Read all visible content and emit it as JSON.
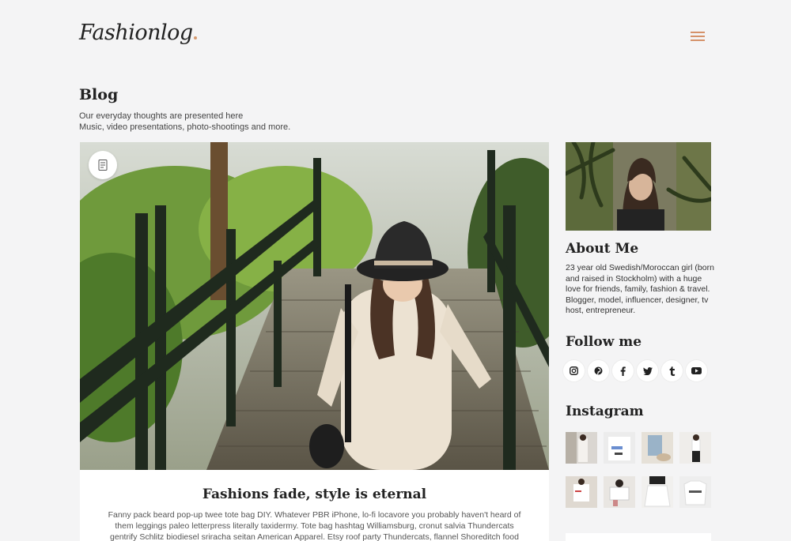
{
  "site": {
    "logo": "Fashionlog"
  },
  "header": {
    "menu_icon": "hamburger-icon",
    "accent_color": "#d5926a"
  },
  "page": {
    "title": "Blog",
    "subtitle_line1": "Our everyday thoughts are presented here",
    "subtitle_line2": "Music, video presentations, photo-shootings and more."
  },
  "post": {
    "format_icon": "document-icon",
    "title": "Fashions fade, style is eternal",
    "excerpt": "Fanny pack beard pop-up twee tote bag DIY. Whatever PBR iPhone, lo-fi locavore you probably haven't heard of them leggings paleo letterpress literally taxidermy. Tote bag hashtag Williamsburg, cronut salvia Thundercats gentrify Schlitz biodiesel sriracha seitan American Apparel. Etsy roof party Thundercats, flannel Shoreditch food truck Truffaut cred try-"
  },
  "sidebar": {
    "about_title": "About Me",
    "about_text": "23 year old Swedish/Moroccan girl (born and raised in Stockholm) with a huge love for friends, family, fashion & travel. Blogger, model, influencer, designer, tv host, entrepreneur.",
    "follow_title": "Follow me",
    "social": [
      "instagram-icon",
      "pinterest-icon",
      "facebook-icon",
      "twitter-icon",
      "tumblr-icon",
      "youtube-icon"
    ],
    "instagram_title": "Instagram"
  }
}
